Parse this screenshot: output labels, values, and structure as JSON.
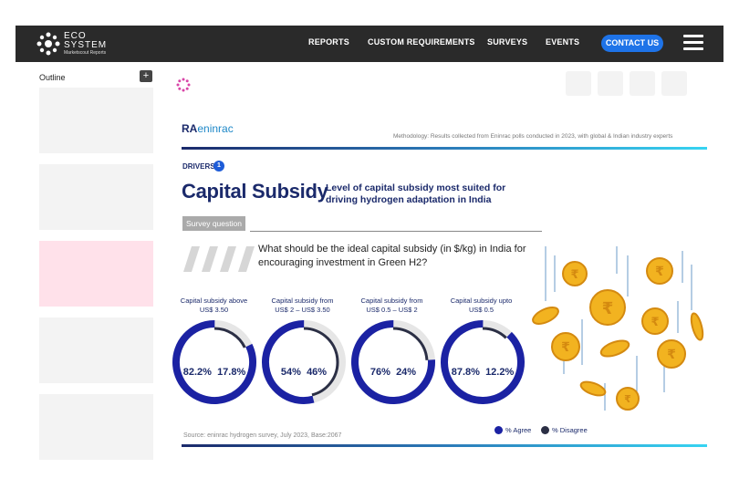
{
  "navbar": {
    "logo": {
      "line1": "ECO",
      "line2": "SYSTEM",
      "line3": "Marketscout Reports"
    },
    "items": [
      "REPORTS",
      "CUSTOM REQUIREMENTS",
      "SURVEYS",
      "EVENTS"
    ],
    "contact_label": "CONTACT US",
    "icons": [
      "snowflake-logo-icon",
      "hamburger-menu-icon"
    ]
  },
  "sidebar": {
    "title": "Outline",
    "add_icon": "plus-icon",
    "thumbnails": 5,
    "active_index": 2
  },
  "toolbar": {
    "icons": [
      "loading-spinner-icon"
    ],
    "buttons": 4
  },
  "slide": {
    "brand": {
      "part1": "RA",
      "part2": "eninrac"
    },
    "methodology": "Methodology: Results collected from Eninrac polls conducted in 2023, with global & Indian industry experts",
    "drivers_label": "DRIVERS",
    "drivers_number": "1",
    "title": "Capital Subsidy",
    "subtitle": "Level of capital subsidy most suited for driving hydrogen adaptation in India",
    "survey_tag": "Survey question",
    "question": "What should be the ideal capital subsidy (in $/kg) in India for encouraging investment in Green H2?",
    "source": "Source: eninrac hydrogen survey, July 2023, Base:2067",
    "legend": {
      "agree": "% Agree",
      "disagree": "% Disagree"
    },
    "colors": {
      "agree": "#1b22a3",
      "disagree": "#2b2f45",
      "track": "#e6e6e6",
      "accent": "#1e73e8"
    },
    "donuts": [
      {
        "label1": "Capital subsidy above",
        "label2": "US$ 3.50",
        "agree": "82.2%",
        "disagree": "17.8%",
        "agree_value": 82.2,
        "disagree_value": 17.8
      },
      {
        "label1": "Capital subsidy from",
        "label2": "US$ 2 – US$ 3.50",
        "agree": "54%",
        "disagree": "46%",
        "agree_value": 54,
        "disagree_value": 46
      },
      {
        "label1": "Capital subsidy from",
        "label2": "US$ 0.5 – US$ 2",
        "agree": "76%",
        "disagree": "24%",
        "agree_value": 76,
        "disagree_value": 24
      },
      {
        "label1": "Capital subsidy upto",
        "label2": "US$ 0.5",
        "agree": "87.8%",
        "disagree": "12.2%",
        "agree_value": 87.8,
        "disagree_value": 12.2
      }
    ]
  }
}
